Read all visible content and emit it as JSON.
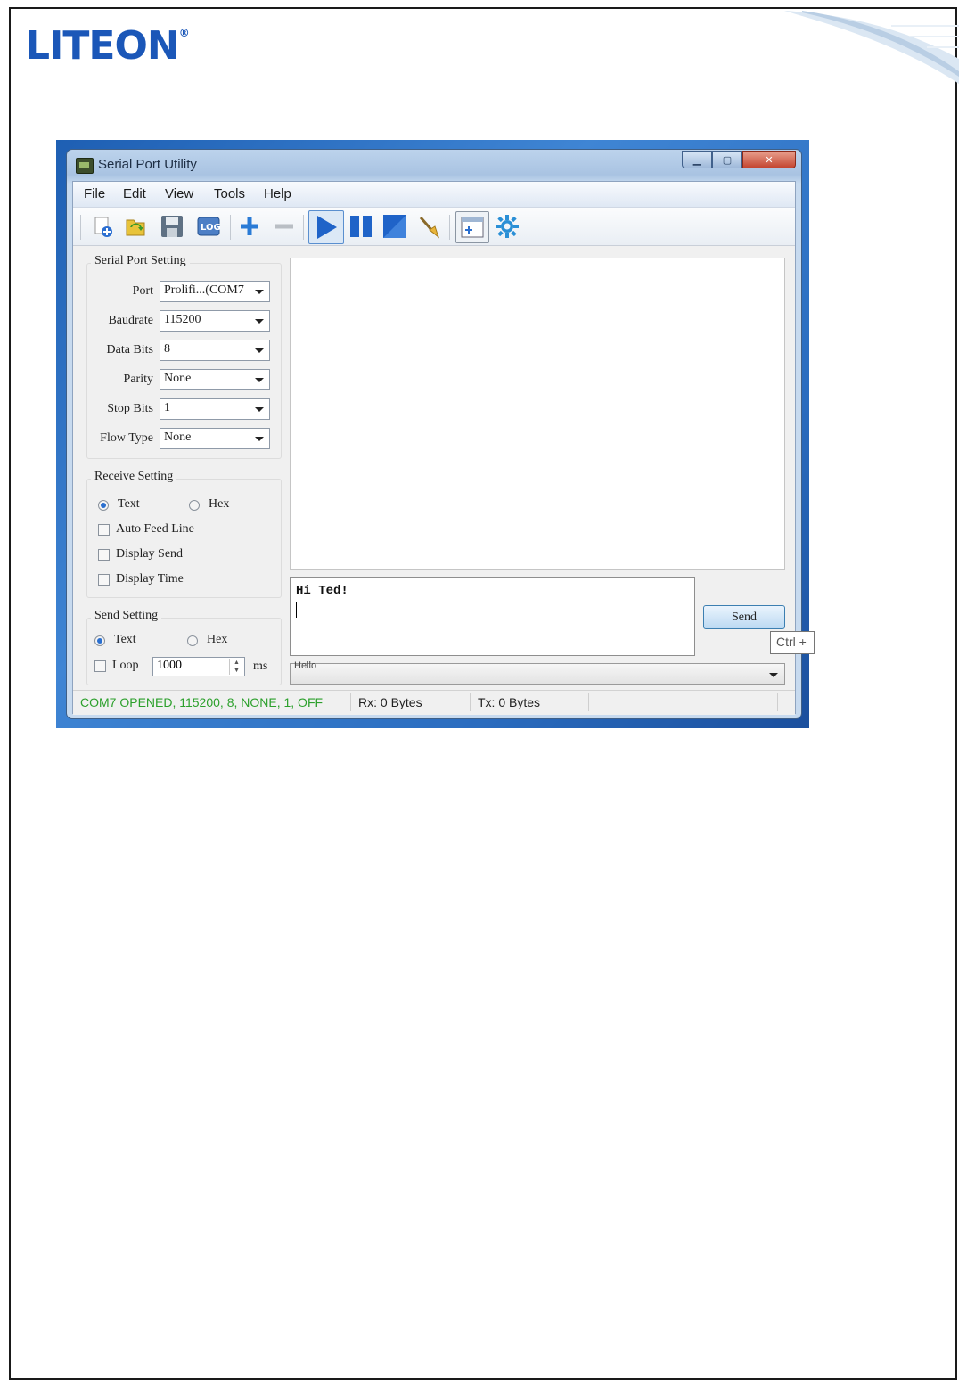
{
  "logo": {
    "text": "LITEON",
    "mark": "®"
  },
  "window": {
    "title": "Serial Port Utility"
  },
  "menu": [
    "File",
    "Edit",
    "View",
    "Tools",
    "Help"
  ],
  "toolbar": [
    "new-icon",
    "open-icon",
    "save-icon",
    "log-icon",
    "add-icon",
    "remove-icon",
    "play-icon",
    "pause-icon",
    "stop-icon",
    "clear-icon",
    "window-icon",
    "settings-icon"
  ],
  "serial_port": {
    "title": "Serial Port Setting",
    "port_label": "Port",
    "port_value": "Prolifi...(COM7",
    "baud_label": "Baudrate",
    "baud_value": "115200",
    "data_label": "Data Bits",
    "data_value": "8",
    "parity_label": "Parity",
    "parity_value": "None",
    "stop_label": "Stop Bits",
    "stop_value": "1",
    "flow_label": "Flow Type",
    "flow_value": "None"
  },
  "receive": {
    "title": "Receive Setting",
    "text_label": "Text",
    "hex_label": "Hex",
    "auto_feed": "Auto Feed Line",
    "display_send": "Display Send",
    "display_time": "Display Time"
  },
  "send": {
    "title": "Send Setting",
    "text_label": "Text",
    "hex_label": "Hex",
    "loop_label": "Loop",
    "loop_value": "1000",
    "loop_unit": "ms",
    "content": "Hi Ted!",
    "button": "Send",
    "tooltip": "Ctrl +",
    "history": "Hello"
  },
  "status": {
    "port_state": "COM7 OPENED, 115200, 8, NONE, 1, OFF",
    "rx": "Rx: 0 Bytes",
    "tx": "Tx: 0 Bytes"
  },
  "colors": {
    "status_ok": "#2ca02c",
    "brand": "#1b57b8",
    "accent": "#2a6fcf"
  }
}
